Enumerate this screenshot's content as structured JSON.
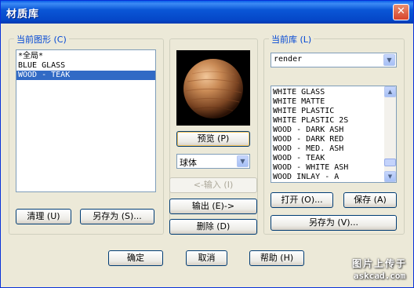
{
  "window": {
    "title": "材质库",
    "close_glyph": "✕"
  },
  "current_drawing": {
    "label": "当前图形 (C)",
    "items": [
      "*全局*",
      "BLUE GLASS",
      "WOOD - TEAK"
    ],
    "selected_index": 2,
    "purge_label": "清理 (U)",
    "save_as_label": "另存为 (S)..."
  },
  "center": {
    "preview_label": "预览 (P)",
    "shape_value": "球体",
    "import_label": "<-输入 (I)",
    "export_label": "输出 (E)->",
    "delete_label": "删除 (D)"
  },
  "current_library": {
    "label": "当前库 (L)",
    "library_value": "render",
    "items": [
      "WHITE GLASS",
      "WHITE MATTE",
      "WHITE PLASTIC",
      "WHITE PLASTIC 2S",
      "WOOD - DARK ASH",
      "WOOD - DARK RED",
      "WOOD - MED. ASH",
      "WOOD - TEAK",
      "WOOD - WHITE ASH",
      "WOOD INLAY - A"
    ],
    "open_label": "打开 (O)...",
    "save_label": "保存 (A)",
    "save_as_label": "另存为 (V)..."
  },
  "footer": {
    "ok_label": "确定",
    "cancel_label": "取消",
    "help_label": "帮助 (H)"
  },
  "watermark": {
    "line1": "图片上传于",
    "line2": "askcad.com"
  },
  "colors": {
    "title_bar": "#0a56d6",
    "selection": "#316ac5",
    "face": "#ece9d8",
    "group_label": "#0046d5"
  }
}
